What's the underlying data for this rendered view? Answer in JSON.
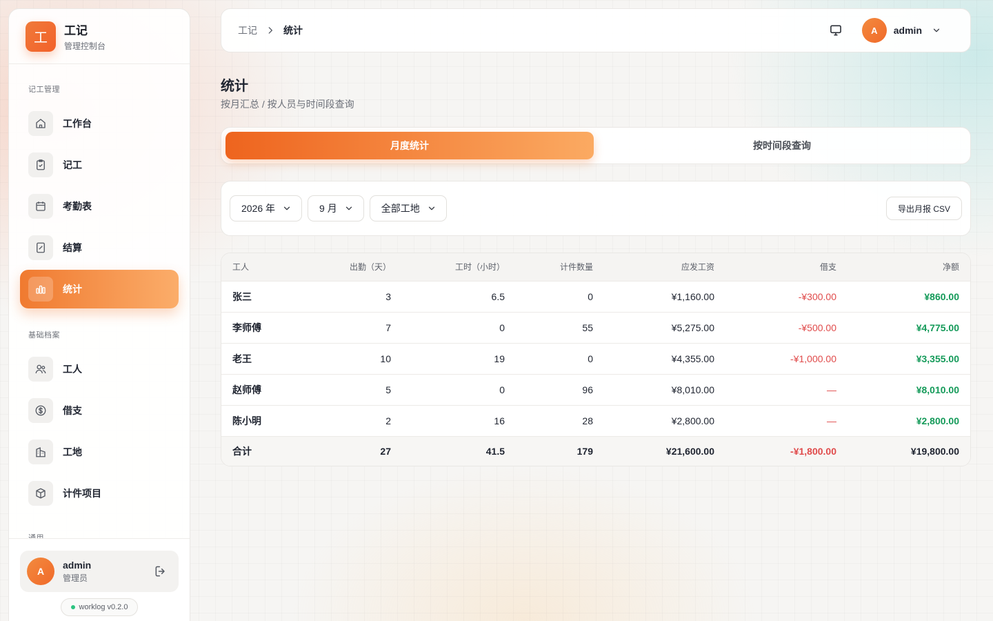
{
  "brand": {
    "logo_char": "工",
    "title": "工记",
    "subtitle": "管理控制台"
  },
  "sidebar": {
    "section_record": "记工管理",
    "section_base": "基础档案",
    "section_general": "通用",
    "items": [
      {
        "label": "工作台",
        "icon": "home-icon"
      },
      {
        "label": "记工",
        "icon": "clipboard-check-icon"
      },
      {
        "label": "考勤表",
        "icon": "calendar-icon"
      },
      {
        "label": "结算",
        "icon": "receipt-icon"
      },
      {
        "label": "统计",
        "icon": "bar-chart-icon",
        "active": true
      },
      {
        "label": "工人",
        "icon": "users-icon"
      },
      {
        "label": "借支",
        "icon": "dollar-circle-icon"
      },
      {
        "label": "工地",
        "icon": "building-icon"
      },
      {
        "label": "计件项目",
        "icon": "box-icon"
      }
    ],
    "user": {
      "avatar": "A",
      "name": "admin",
      "role": "管理员"
    },
    "version": "worklog v0.2.0"
  },
  "topbar": {
    "breadcrumb_root": "工记",
    "breadcrumb_current": "统计",
    "avatar": "A",
    "user": "admin"
  },
  "page": {
    "title": "统计",
    "subtitle": "按月汇总 / 按人员与时间段查询"
  },
  "tabs": [
    {
      "label": "月度统计",
      "active": true
    },
    {
      "label": "按时间段查询",
      "active": false
    }
  ],
  "filters": {
    "year": "2026 年",
    "month": "9 月",
    "site": "全部工地",
    "export_label": "导出月报 CSV"
  },
  "table": {
    "headers": [
      "工人",
      "出勤（天）",
      "工时（小时）",
      "计件数量",
      "应发工资",
      "借支",
      "净额"
    ],
    "rows": [
      {
        "name": "张三",
        "days": "3",
        "hours": "6.5",
        "pieces": "0",
        "wage": "¥1,160.00",
        "advance": "-¥300.00",
        "net": "¥860.00"
      },
      {
        "name": "李师傅",
        "days": "7",
        "hours": "0",
        "pieces": "55",
        "wage": "¥5,275.00",
        "advance": "-¥500.00",
        "net": "¥4,775.00"
      },
      {
        "name": "老王",
        "days": "10",
        "hours": "19",
        "pieces": "0",
        "wage": "¥4,355.00",
        "advance": "-¥1,000.00",
        "net": "¥3,355.00"
      },
      {
        "name": "赵师傅",
        "days": "5",
        "hours": "0",
        "pieces": "96",
        "wage": "¥8,010.00",
        "advance": "—",
        "net": "¥8,010.00"
      },
      {
        "name": "陈小明",
        "days": "2",
        "hours": "16",
        "pieces": "28",
        "wage": "¥2,800.00",
        "advance": "—",
        "net": "¥2,800.00"
      }
    ],
    "total": {
      "name": "合计",
      "days": "27",
      "hours": "41.5",
      "pieces": "179",
      "wage": "¥21,600.00",
      "advance": "-¥1,800.00",
      "net": "¥19,800.00"
    }
  },
  "colors": {
    "accent": "#f07a30",
    "negative": "#e04b4b",
    "positive": "#149a59"
  }
}
